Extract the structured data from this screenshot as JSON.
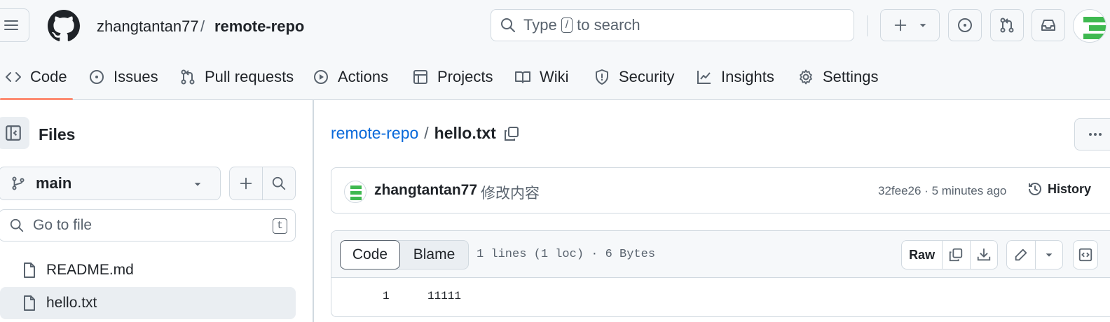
{
  "header": {
    "owner": "zhangtantan77",
    "separator": "/",
    "repo": "remote-repo",
    "search": {
      "prefix": "Type",
      "key": "/",
      "suffix": "to search"
    }
  },
  "nav": {
    "tabs": [
      {
        "label": "Code",
        "icon": "code-icon",
        "active": true
      },
      {
        "label": "Issues",
        "icon": "issue-opened-icon"
      },
      {
        "label": "Pull requests",
        "icon": "git-pull-request-icon"
      },
      {
        "label": "Actions",
        "icon": "play-icon"
      },
      {
        "label": "Projects",
        "icon": "table-icon"
      },
      {
        "label": "Wiki",
        "icon": "book-icon"
      },
      {
        "label": "Security",
        "icon": "shield-icon"
      },
      {
        "label": "Insights",
        "icon": "graph-icon"
      },
      {
        "label": "Settings",
        "icon": "gear-icon"
      }
    ],
    "active_color": "#fd8c73"
  },
  "sidebar": {
    "title": "Files",
    "branch": "main",
    "goto_placeholder": "Go to file",
    "goto_key": "t",
    "files": [
      {
        "name": "README.md",
        "active": false
      },
      {
        "name": "hello.txt",
        "active": true
      }
    ]
  },
  "main": {
    "path": {
      "repo": "remote-repo",
      "separator": "/",
      "file": "hello.txt"
    },
    "commit": {
      "author": "zhangtantan77",
      "message": "修改内容",
      "sha": "32fee26",
      "time": "5 minutes ago",
      "history_label": "History"
    },
    "file": {
      "view_tabs": [
        "Code",
        "Blame"
      ],
      "active_view": "Code",
      "meta": "1 lines (1 loc) · 6 Bytes",
      "raw_label": "Raw",
      "lines": [
        {
          "number": "1",
          "text": "11111"
        }
      ]
    }
  },
  "colors": {
    "link": "#0969da",
    "avatar_green": "#3fb950",
    "border": "#d1d9e0"
  }
}
